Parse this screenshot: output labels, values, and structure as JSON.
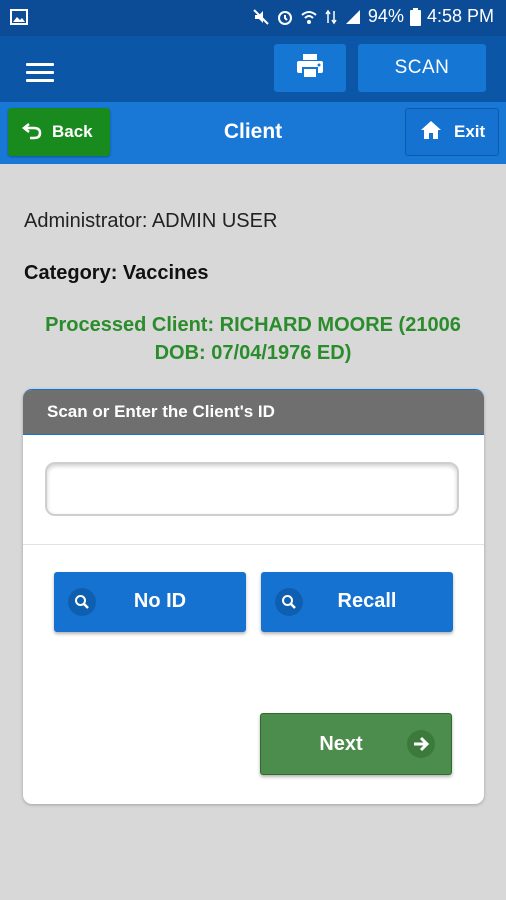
{
  "status_bar": {
    "battery_percent": "94%",
    "time": "4:58 PM"
  },
  "app_bar": {
    "scan_label": "SCAN",
    "print_icon": "printer-icon",
    "menu_icon": "hamburger-icon"
  },
  "nav_bar": {
    "back_label": "Back",
    "title": "Client",
    "exit_label": "Exit"
  },
  "info": {
    "administrator": "Administrator: ADMIN USER",
    "category": "Category: Vaccines",
    "processed_line1": "Processed Client: RICHARD MOORE (21006",
    "processed_line2": "DOB: 07/04/1976 ED)"
  },
  "card": {
    "header": "Scan or Enter the Client's ID",
    "input_value": "",
    "input_placeholder": "",
    "no_id_label": "No ID",
    "recall_label": "Recall",
    "next_label": "Next"
  },
  "colors": {
    "status_bar": "#0c4c97",
    "app_bar": "#0c56a8",
    "nav_bar": "#1978d6",
    "back_button": "#188a1e",
    "processed_text": "#2a8c2a",
    "next_button": "#4c8c4c",
    "blue_button": "#1672d0"
  }
}
